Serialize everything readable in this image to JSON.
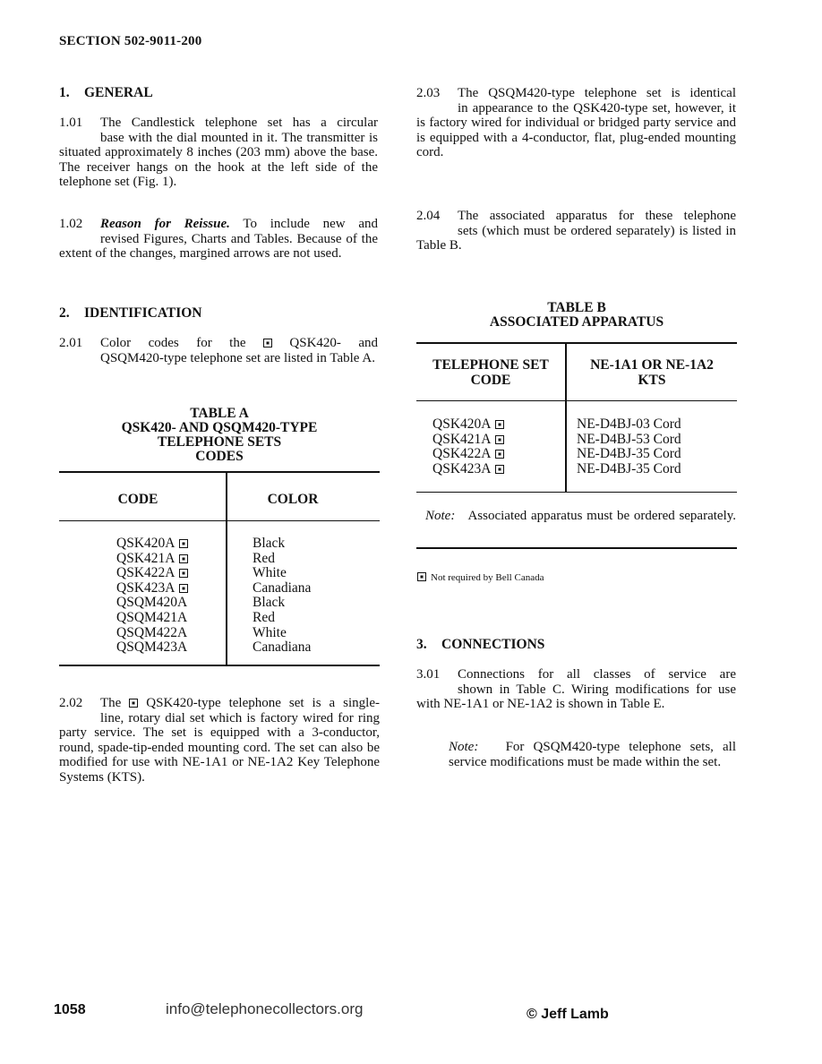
{
  "header": {
    "section": "SECTION 502-9011-200"
  },
  "left": {
    "s1": {
      "num": "1.",
      "title": "GENERAL"
    },
    "p101": {
      "num": "1.01",
      "line1": "The Candlestick telephone set has a circular",
      "rest": "base with the dial mounted in it. The transmitter is situated approximately 8 inches (203 mm) above the base. The receiver hangs on the hook at the left side of the telephone set (Fig. 1)."
    },
    "p102": {
      "num": "1.02",
      "lead": "Reason for Reissue.",
      "line1_rest": " To include new and",
      "rest": "revised Figures, Charts and Tables. Because of the extent of the changes, margined arrows are not used."
    },
    "s2": {
      "num": "2.",
      "title": "IDENTIFICATION"
    },
    "p201": {
      "num": "2.01",
      "pre": "Color codes for the",
      "post": "QSK420- and",
      "rest": "QSQM420-type telephone set are listed in Table A."
    },
    "tableA": {
      "title": [
        "TABLE A",
        "QSK420- AND QSQM420-TYPE",
        "TELEPHONE SETS",
        "CODES"
      ],
      "headers": [
        "CODE",
        "COLOR"
      ],
      "rows": [
        {
          "code": "QSK420A",
          "marked": true,
          "color": "Black"
        },
        {
          "code": "QSK421A",
          "marked": true,
          "color": "Red"
        },
        {
          "code": "QSK422A",
          "marked": true,
          "color": "White"
        },
        {
          "code": "QSK423A",
          "marked": true,
          "color": "Canadiana"
        },
        {
          "code": "QSQM420A",
          "marked": false,
          "color": "Black"
        },
        {
          "code": "QSQM421A",
          "marked": false,
          "color": "Red"
        },
        {
          "code": "QSQM422A",
          "marked": false,
          "color": "White"
        },
        {
          "code": "QSQM423A",
          "marked": false,
          "color": "Canadiana"
        }
      ]
    },
    "p202": {
      "num": "2.02",
      "pre": "The",
      "post": "QSK420-type telephone set is a single-",
      "rest": "line, rotary dial set which is factory wired for ring party service. The set is equipped with a 3-conductor, round, spade-tip-ended mounting cord. The set can also be modified for use with NE-1A1 or NE-1A2 Key Telephone Systems (KTS)."
    }
  },
  "right": {
    "p203": {
      "num": "2.03",
      "line1": "The QSQM420-type telephone set is identical",
      "rest": "in appearance to the QSK420-type set, however, it is factory wired for individual or bridged party service and is equipped with a 4-conductor, flat, plug-ended mounting cord."
    },
    "p204": {
      "num": "2.04",
      "line1": "The associated apparatus for these telephone",
      "rest": "sets (which must be ordered separately) is listed in Table B."
    },
    "tableB": {
      "title": [
        "TABLE B",
        "ASSOCIATED APPARATUS"
      ],
      "headers": [
        "TELEPHONE SET\nCODE",
        "NE-1A1 OR NE-1A2\nKTS"
      ],
      "header1": [
        "TELEPHONE SET",
        "CODE"
      ],
      "header2": [
        "NE-1A1 OR NE-1A2",
        "KTS"
      ],
      "rows": [
        {
          "code": "QSK420A",
          "marked": true,
          "apparatus": "NE-D4BJ-03 Cord"
        },
        {
          "code": "QSK421A",
          "marked": true,
          "apparatus": "NE-D4BJ-53 Cord"
        },
        {
          "code": "QSK422A",
          "marked": true,
          "apparatus": "NE-D4BJ-35 Cord"
        },
        {
          "code": "QSK423A",
          "marked": true,
          "apparatus": "NE-D4BJ-35 Cord"
        }
      ],
      "note_label": "Note:",
      "note_text": "Associated apparatus must be ordered separately."
    },
    "footnote": "Not required by Bell Canada",
    "s3": {
      "num": "3.",
      "title": "CONNECTIONS"
    },
    "p301": {
      "num": "3.01",
      "line1": "Connections for all classes of service are",
      "rest": "shown in Table C. Wiring modifications for use with NE-1A1 or NE-1A2 is shown in Table E."
    },
    "note2": {
      "label": "Note:",
      "text": "For QSQM420-type telephone sets, all service modifications must be made within the set."
    }
  },
  "footer": {
    "page": "1058",
    "email": "info@telephonecollectors.org",
    "copyright": "© Jeff Lamb"
  }
}
